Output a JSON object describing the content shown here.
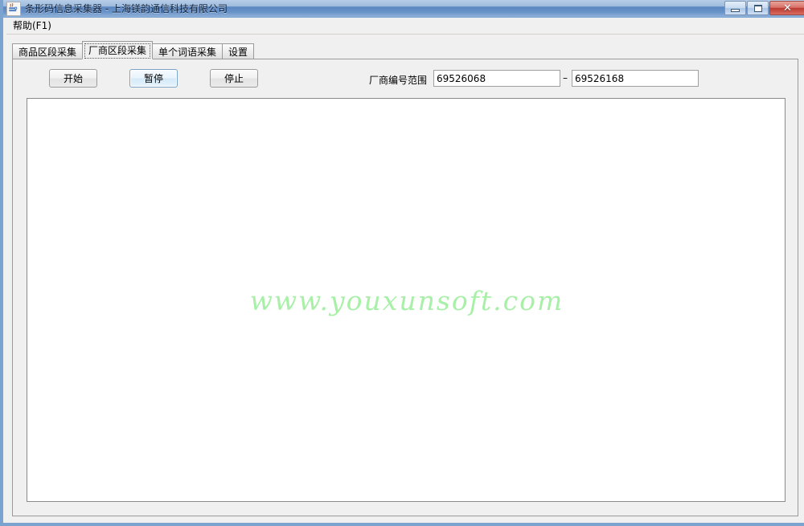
{
  "window": {
    "title": "条形码信息采集器 - 上海镁韵通信科技有限公司",
    "icon": "java-coffee-cup-icon",
    "controls": {
      "minimize_label": "",
      "maximize_label": "",
      "close_label": "✕"
    },
    "frame_color": "#7ba3d0",
    "titlebar_accent": "#5b86c0"
  },
  "menubar": {
    "items": [
      {
        "label": "帮助(F1)",
        "name": "menu-help"
      }
    ]
  },
  "tabs": [
    {
      "label": "商品区段采集",
      "name": "tab-product-segment",
      "selected": false
    },
    {
      "label": "厂商区段采集",
      "name": "tab-manufacturer-segment",
      "selected": true
    },
    {
      "label": "单个词语采集",
      "name": "tab-single-word",
      "selected": false
    },
    {
      "label": "设置",
      "name": "tab-settings",
      "selected": false
    }
  ],
  "toolbar": {
    "start_label": "开始",
    "pause_label": "暂停",
    "stop_label": "停止",
    "range_label": "厂商编号范围",
    "range_separator": "–",
    "range_from_value": "69526068",
    "range_to_value": "69526168",
    "range_from_placeholder": "",
    "range_to_placeholder": ""
  },
  "content": {
    "watermark_text": "www.youxunsoft.com",
    "watermark_color": "#a8f0a8",
    "result_text": ""
  }
}
